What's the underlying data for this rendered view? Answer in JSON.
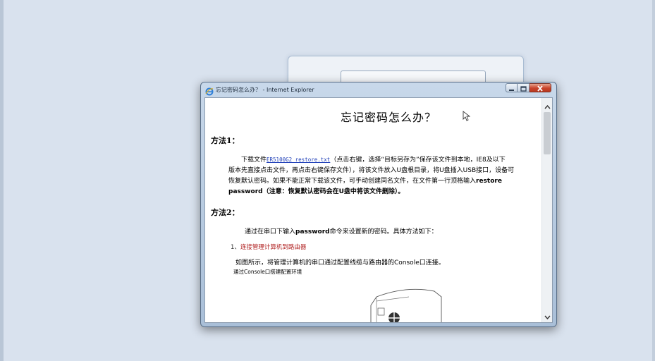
{
  "window": {
    "title": "忘记密码怎么办？ - Internet Explorer"
  },
  "document": {
    "title": "忘记密码怎么办？",
    "method1": {
      "heading": "方法1：",
      "text_prefix": "下载文件",
      "link": "ER5100G2_restore.txt",
      "text_after_link": "（点击右键，选择“目标另存为”保存该文件到本地，IE8及以下",
      "line2": "版本先直接点击文件，再点击右键保存文件），将该文件放入U盘根目录，将U盘插入USB接口，设备可",
      "line3": "恢复默认密码。如果不能正常下载该文件，可手动创建同名文件，在文件第一行顶格输入",
      "bold_restore": "restore",
      "bold_line4": "password（注意：恢复默认密码会在U盘中将该文件删除）。"
    },
    "method2": {
      "heading": "方法2：",
      "intro_prefix": "通过在串口下输入",
      "intro_bold": "password",
      "intro_suffix": "命令来设置新的密码。具体方法如下：",
      "step1_num": "1、",
      "step1_label": "连接管理计算机到路由器",
      "step1_desc": "如图所示，将管理计算机的串口通过配置线缆与路由器的Console口连接。",
      "caption": "通过Console口搭建配置环境"
    }
  },
  "icons": {
    "app": "ie-icon",
    "minimize": "minimize-icon",
    "maximize": "maximize-icon",
    "close": "close-icon",
    "scroll_up": "chevron-up-icon",
    "scroll_down": "chevron-down-icon",
    "cursor": "mouse-pointer-icon"
  },
  "colors": {
    "desktop": "#d9e2ee",
    "link": "#1f3fb8",
    "step_label": "#b02020",
    "close_button": "#c8432a"
  }
}
